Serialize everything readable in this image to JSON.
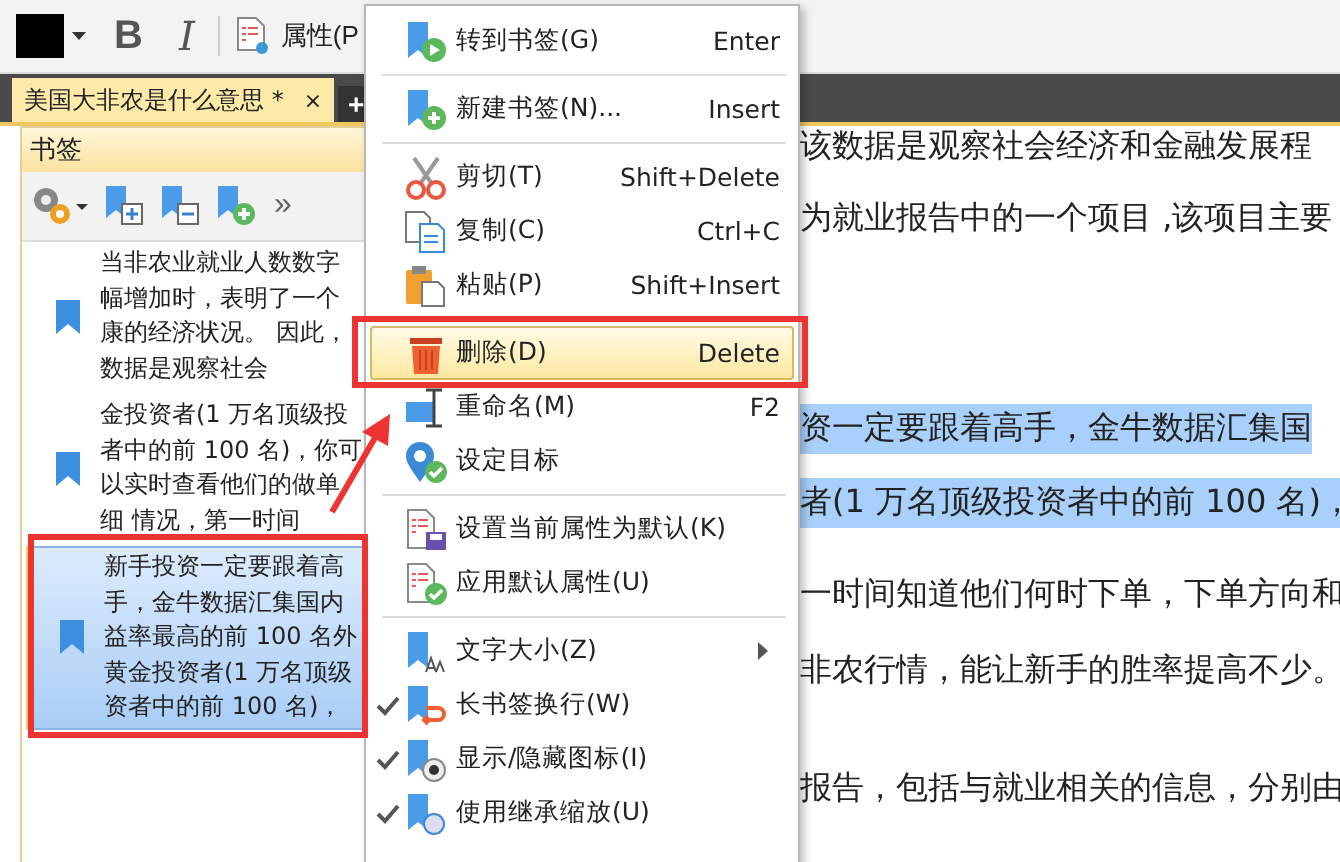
{
  "toolbar": {
    "bold_label": "B",
    "italic_label": "I",
    "properties_label": "属性(P"
  },
  "tabs": [
    {
      "label": "美国大非农是什么意思 *",
      "close": "×",
      "selected": true
    },
    {
      "label": "+",
      "selected": false
    }
  ],
  "bookmarks_panel": {
    "title": "书签",
    "more": "»",
    "items": [
      {
        "lines": [
          "当非农业就业人数数字",
          "幅增加时，表明了一个",
          "康的经济状况。 因此，",
          "数据是观察社会"
        ],
        "selected": false
      },
      {
        "lines": [
          "金投资者(1 万名顶级投",
          "者中的前 100 名)，你可",
          "以实时查看他们的做单",
          "细 情况，第一时间"
        ],
        "selected": false
      },
      {
        "lines": [
          "新手投资一定要跟着高",
          "手，金牛数据汇集国内",
          "益率最高的前 100 名外",
          "黄金投资者(1 万名顶级",
          "资者中的前 100 名)，"
        ],
        "selected": true
      }
    ]
  },
  "document": {
    "lines": [
      {
        "text": "该数据是观察社会经济和金融发展程",
        "highlighted": false
      },
      {
        "text": "为就业报告中的一个项目 ,该项目主要",
        "highlighted": false
      },
      {
        "text": "资一定要跟着高手，金牛数据汇集国",
        "highlighted": true
      },
      {
        "text": "者(1 万名顶级投资者中的前 100 名)，",
        "highlighted": true
      },
      {
        "text": "一时间知道他们何时下单，下单方向和",
        "highlighted": false
      },
      {
        "text": "非农行情，能让新手的胜率提高不少。",
        "highlighted": false
      },
      {
        "text": "报告，包括与就业相关的信息，分别由",
        "highlighted": false
      }
    ]
  },
  "context_menu": {
    "items": [
      {
        "kind": "action",
        "label": "转到书签(G)",
        "shortcut": "Enter",
        "highlighted": false,
        "checked": false
      },
      {
        "kind": "separator"
      },
      {
        "kind": "action",
        "label": "新建书签(N)...",
        "shortcut": "Insert",
        "highlighted": false,
        "checked": false
      },
      {
        "kind": "separator"
      },
      {
        "kind": "action",
        "label": "剪切(T)",
        "shortcut": "Shift+Delete",
        "highlighted": false,
        "checked": false
      },
      {
        "kind": "action",
        "label": "复制(C)",
        "shortcut": "Ctrl+C",
        "highlighted": false,
        "checked": false
      },
      {
        "kind": "action",
        "label": "粘贴(P)",
        "shortcut": "Shift+Insert",
        "highlighted": false,
        "checked": false
      },
      {
        "kind": "separator"
      },
      {
        "kind": "action",
        "label": "删除(D)",
        "shortcut": "Delete",
        "highlighted": true,
        "checked": false
      },
      {
        "kind": "action",
        "label": "重命名(M)",
        "shortcut": "F2",
        "highlighted": false,
        "checked": false
      },
      {
        "kind": "action",
        "label": "设定目标",
        "highlighted": false,
        "checked": false
      },
      {
        "kind": "separator"
      },
      {
        "kind": "action",
        "label": "设置当前属性为默认(K)",
        "highlighted": false,
        "checked": false
      },
      {
        "kind": "action",
        "label": "应用默认属性(U)",
        "highlighted": false,
        "checked": false
      },
      {
        "kind": "separator"
      },
      {
        "kind": "submenu",
        "label": "文字大小(Z)",
        "highlighted": false,
        "checked": false
      },
      {
        "kind": "toggle",
        "label": "长书签换行(W)",
        "highlighted": false,
        "checked": true
      },
      {
        "kind": "toggle",
        "label": "显示/隐藏图标(I)",
        "highlighted": false,
        "checked": true
      },
      {
        "kind": "toggle",
        "label": "使用继承缩放(U)",
        "highlighted": false,
        "checked": true
      }
    ]
  }
}
